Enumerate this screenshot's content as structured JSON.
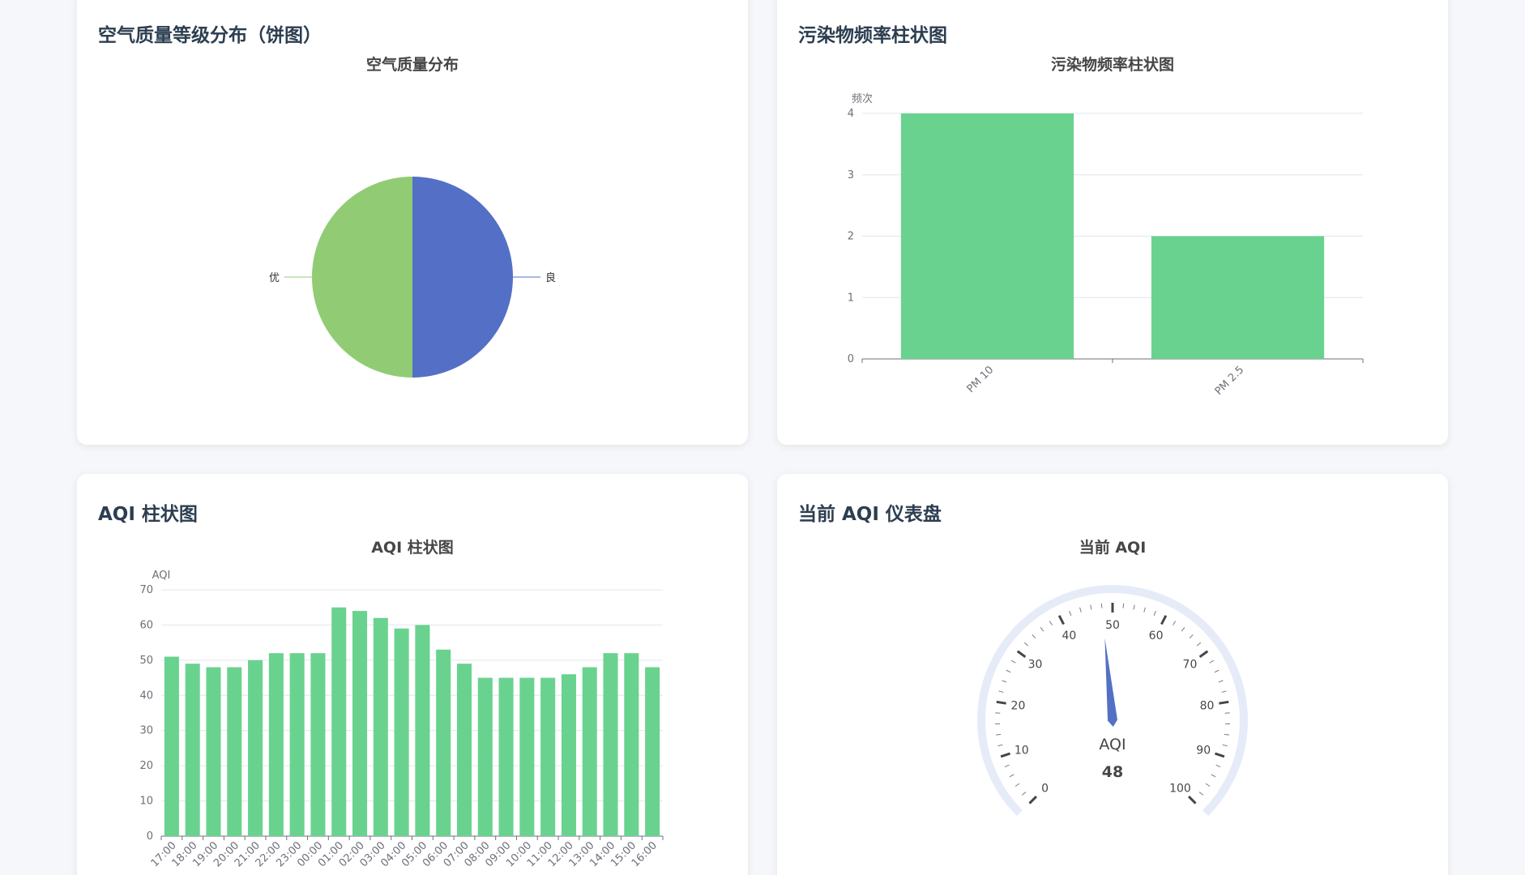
{
  "cards": {
    "pie": {
      "title": "空气质量等级分布（饼图）"
    },
    "pollutant": {
      "title": "污染物频率柱状图"
    },
    "aqi_bar": {
      "title": "AQI 柱状图"
    },
    "gauge": {
      "title": "当前 AQI 仪表盘"
    }
  },
  "colors": {
    "bar": "#6ad28f",
    "pie_good": "#5470c6",
    "pie_excellent": "#91cc75",
    "gauge_pointer": "#5470c6",
    "gauge_track": "#e6ebf8"
  },
  "chart_data": [
    {
      "type": "pie",
      "title": "空气质量分布",
      "slices": [
        {
          "name": "良",
          "value": 1
        },
        {
          "name": "优",
          "value": 1
        }
      ]
    },
    {
      "type": "bar",
      "title": "污染物频率柱状图",
      "ylabel": "频次",
      "ylim": [
        0,
        4
      ],
      "yticks": [
        0,
        1,
        2,
        3,
        4
      ],
      "categories": [
        "PM 10",
        "PM 2.5"
      ],
      "values": [
        4,
        2
      ]
    },
    {
      "type": "bar",
      "title": "AQI 柱状图",
      "ylabel": "AQI",
      "ylim": [
        0,
        70
      ],
      "yticks": [
        0,
        10,
        20,
        30,
        40,
        50,
        60,
        70
      ],
      "categories": [
        "17:00",
        "18:00",
        "19:00",
        "20:00",
        "21:00",
        "22:00",
        "23:00",
        "00:00",
        "01:00",
        "02:00",
        "03:00",
        "04:00",
        "05:00",
        "06:00",
        "07:00",
        "08:00",
        "09:00",
        "10:00",
        "11:00",
        "12:00",
        "13:00",
        "14:00",
        "15:00",
        "16:00"
      ],
      "values": [
        51,
        49,
        48,
        48,
        50,
        52,
        52,
        52,
        65,
        64,
        62,
        59,
        60,
        53,
        49,
        45,
        45,
        45,
        45,
        46,
        48,
        52,
        52,
        48
      ]
    },
    {
      "type": "gauge",
      "title": "当前 AQI",
      "name": "AQI",
      "value": 48,
      "min": 0,
      "max": 100,
      "tick_labels": [
        0,
        10,
        20,
        30,
        40,
        50,
        60,
        70,
        80,
        90,
        100
      ]
    }
  ]
}
